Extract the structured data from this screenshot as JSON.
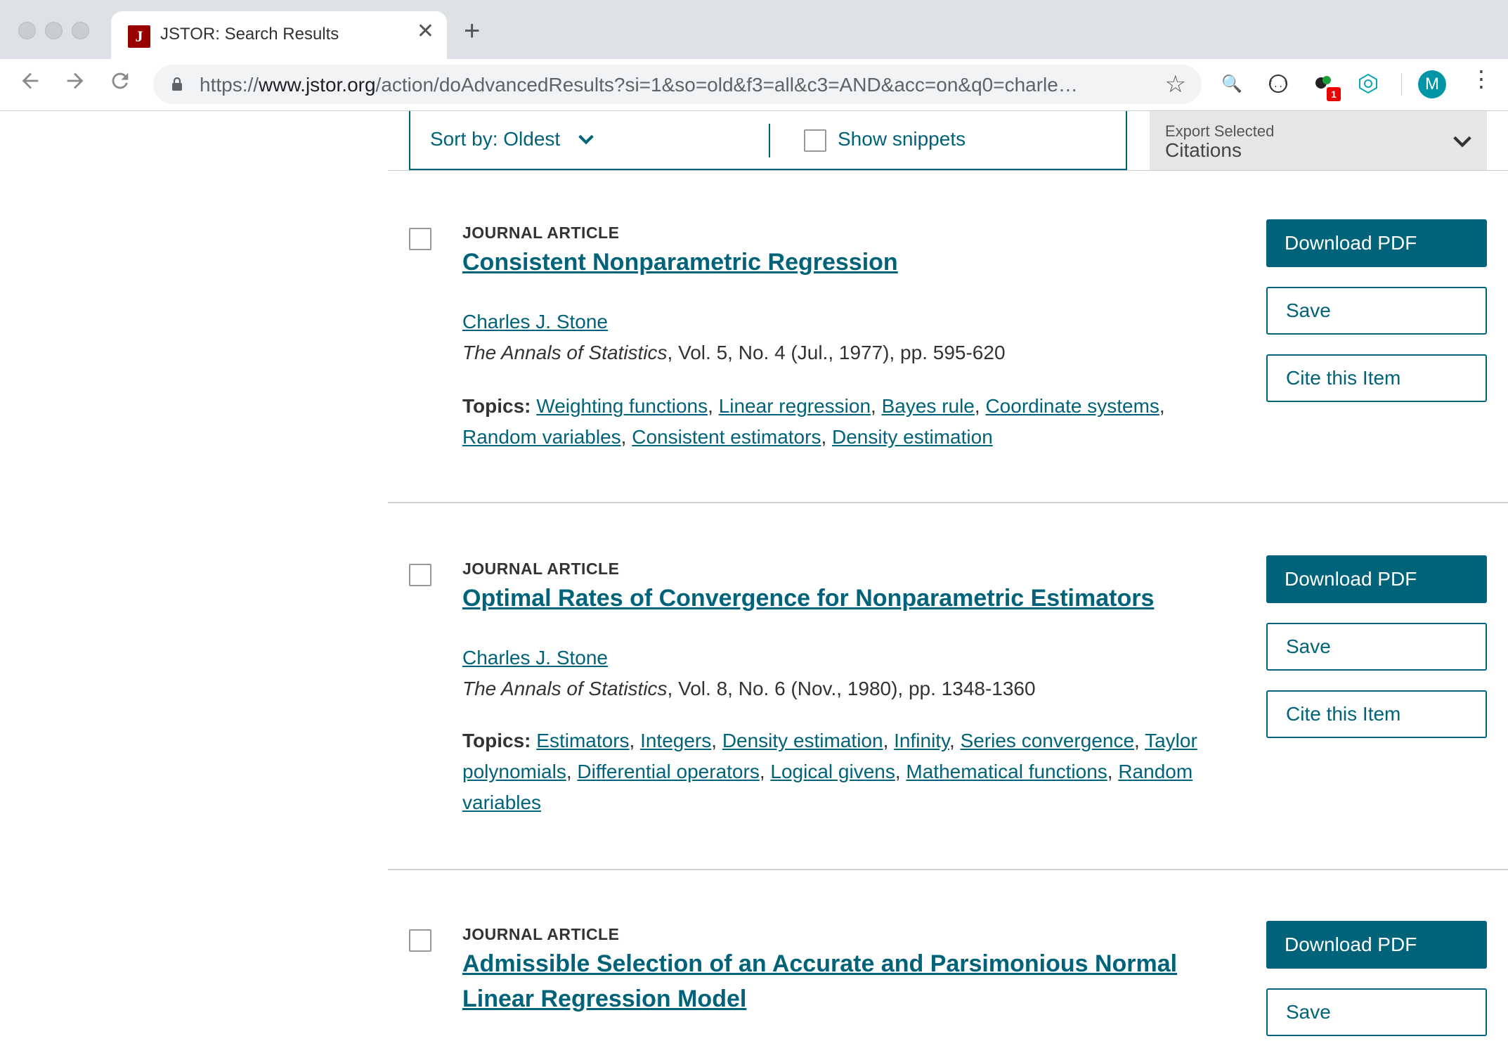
{
  "browser": {
    "tab_title": "JSTOR: Search Results",
    "tab_favicon": "J",
    "close_glyph": "✕",
    "newtab_glyph": "+",
    "url_host_prefix": "https://",
    "url_host": "www.jstor.org",
    "url_path": "/action/doAdvancedResults?si=1&so=old&f3=all&c3=AND&acc=on&q0=charle…",
    "avatar_letter": "M",
    "ext_badge": "1"
  },
  "toolbar": {
    "sort_label": "Sort by: Oldest",
    "snippets_label": "Show snippets",
    "export_top": "Export Selected",
    "export_main": "Citations"
  },
  "results": [
    {
      "type": "JOURNAL ARTICLE",
      "title": "Consistent Nonparametric Regression",
      "author": "Charles J. Stone",
      "journal": "The Annals of Statistics",
      "citation": ", Vol. 5, No. 4 (Jul., 1977), pp. 595-620",
      "topics_label": "Topics:",
      "topics": [
        "Weighting functions",
        "Linear regression",
        "Bayes rule",
        "Coordinate systems",
        "Random variables",
        "Consistent estimators",
        "Density estimation"
      ],
      "download_label": "Download PDF",
      "save_label": "Save",
      "cite_label": "Cite this Item"
    },
    {
      "type": "JOURNAL ARTICLE",
      "title": "Optimal Rates of Convergence for Nonparametric Estimators",
      "author": "Charles J. Stone",
      "journal": "The Annals of Statistics",
      "citation": ", Vol. 8, No. 6 (Nov., 1980), pp. 1348-1360",
      "topics_label": "Topics:",
      "topics": [
        "Estimators",
        "Integers",
        "Density estimation",
        "Infinity",
        "Series convergence",
        "Taylor polynomials",
        "Differential operators",
        "Logical givens",
        "Mathematical functions",
        "Random variables"
      ],
      "download_label": "Download PDF",
      "save_label": "Save",
      "cite_label": "Cite this Item"
    },
    {
      "type": "JOURNAL ARTICLE",
      "title": "Admissible Selection of an Accurate and Parsimonious Normal Linear Regression Model",
      "download_label": "Download PDF",
      "save_label": "Save"
    }
  ],
  "icons": {
    "back": "arrow-left-icon",
    "forward": "arrow-right-icon",
    "reload": "reload-icon",
    "lock": "lock-icon",
    "bookmark": "star-icon",
    "menu": "more-vert-icon"
  },
  "colors": {
    "accent": "#006379",
    "favicon": "#990000",
    "avatar": "#0096a8"
  }
}
